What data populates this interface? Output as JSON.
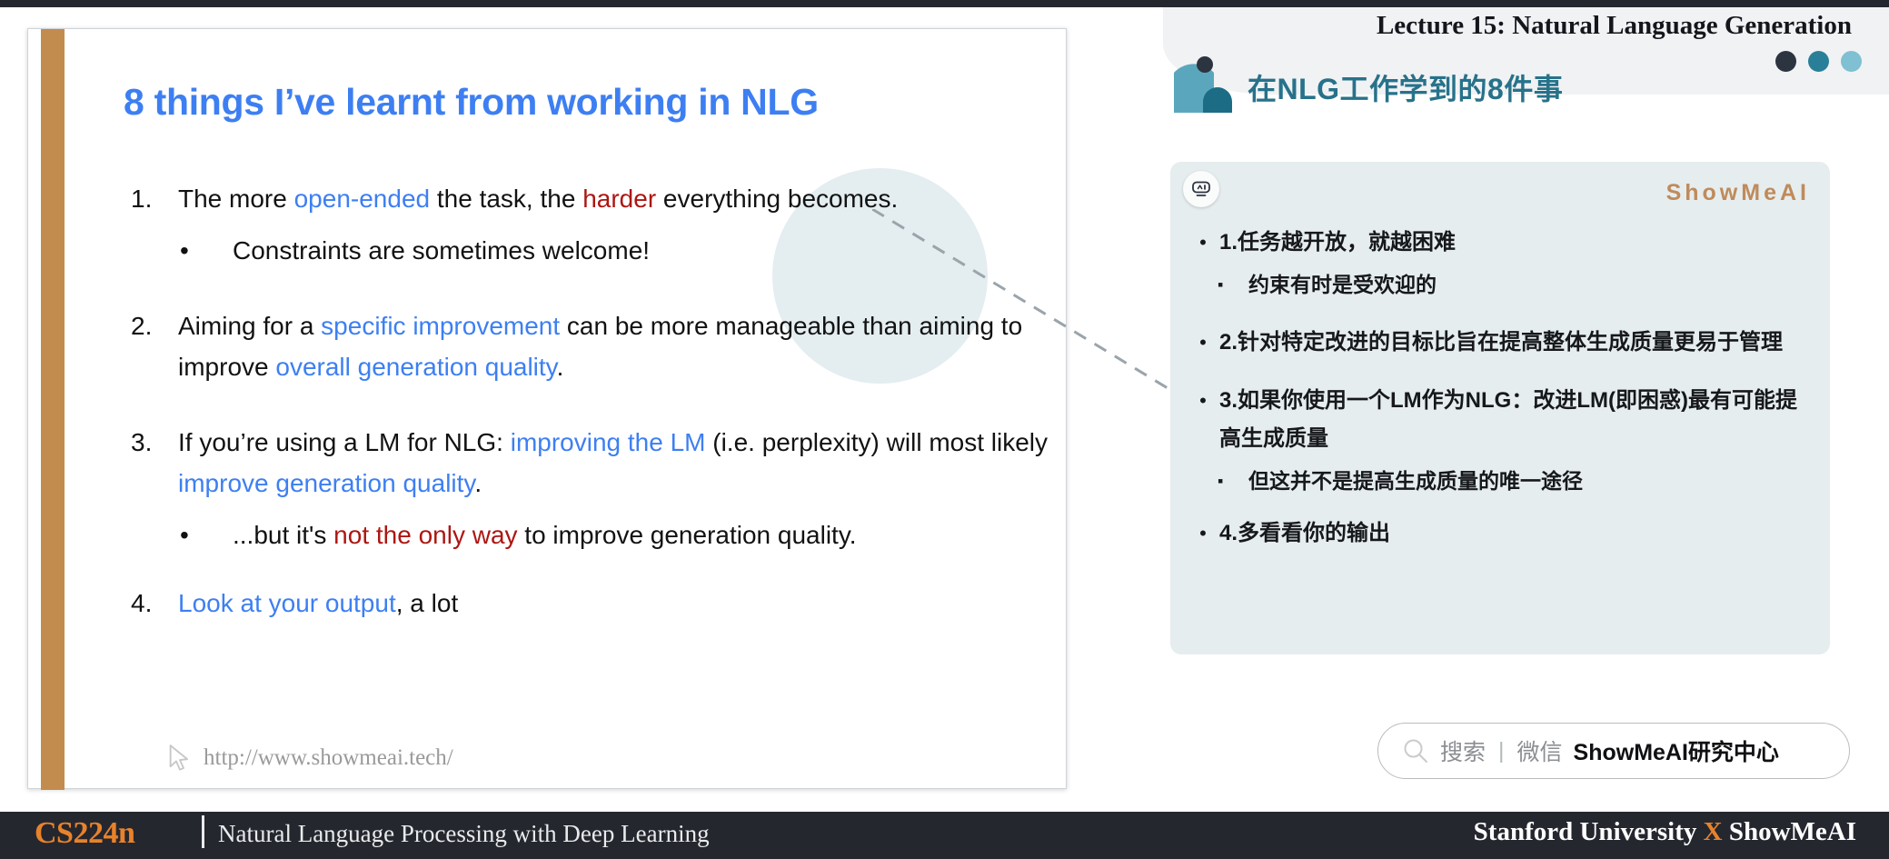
{
  "slide": {
    "title": "8 things I’ve learnt from working in NLG",
    "items": [
      {
        "num": "1.",
        "parts": [
          {
            "t": "The more ",
            "c": "plain"
          },
          {
            "t": "open-ended",
            "c": "blue"
          },
          {
            "t": " the task, the ",
            "c": "plain"
          },
          {
            "t": "harder",
            "c": "red"
          },
          {
            "t": " everything becomes.",
            "c": "plain"
          }
        ],
        "sub": [
          {
            "bullet": "•",
            "parts": [
              {
                "t": "Constraints are sometimes welcome!",
                "c": "plain"
              }
            ]
          }
        ]
      },
      {
        "num": "2.",
        "parts": [
          {
            "t": "Aiming for a ",
            "c": "plain"
          },
          {
            "t": "specific improvement",
            "c": "blue"
          },
          {
            "t": " can be more manageable than aiming to improve ",
            "c": "plain"
          },
          {
            "t": "overall generation quality",
            "c": "blue"
          },
          {
            "t": ".",
            "c": "plain"
          }
        ],
        "sub": []
      },
      {
        "num": "3.",
        "parts": [
          {
            "t": "If you’re using a LM for NLG: ",
            "c": "plain"
          },
          {
            "t": "improving the LM",
            "c": "blue"
          },
          {
            "t": " (i.e. perplexity) will most likely ",
            "c": "plain"
          },
          {
            "t": "improve generation quality",
            "c": "blue"
          },
          {
            "t": ".",
            "c": "plain"
          }
        ],
        "sub": [
          {
            "bullet": "•",
            "parts": [
              {
                "t": "...but it's ",
                "c": "plain"
              },
              {
                "t": "not the only way",
                "c": "red"
              },
              {
                "t": " to improve generation quality.",
                "c": "plain"
              }
            ]
          }
        ]
      },
      {
        "num": "4.",
        "parts": [
          {
            "t": "Look at your output",
            "c": "blue"
          },
          {
            "t": ", a lot",
            "c": "plain"
          }
        ],
        "sub": []
      }
    ],
    "url": "http://www.showmeai.tech/"
  },
  "right_panel": {
    "lecture_title": "Lecture 15: Natural Language Generation",
    "cn_title": "在NLG工作学到的8件事",
    "brand": "ShowMeAI",
    "items": [
      {
        "bullet": "•",
        "text": "1.任务越开放，就越困难",
        "sub": [
          {
            "bullet": "▪",
            "text": "约束有时是受欢迎的"
          }
        ]
      },
      {
        "bullet": "•",
        "text": "2.针对特定改进的目标比旨在提高整体生成质量更易于管理",
        "sub": []
      },
      {
        "bullet": "•",
        "text": "3.如果你使用一个LM作为NLG：改进LM(即困惑)最有可能提高生成质量",
        "sub": [
          {
            "bullet": "▪",
            "text": "但这并不是提高生成质量的唯一途径"
          }
        ]
      },
      {
        "bullet": "•",
        "text": "4.多看看你的输出",
        "sub": []
      }
    ],
    "search": {
      "label": "搜索",
      "divider": "|",
      "channel": "微信",
      "account": "ShowMeAI研究中心"
    }
  },
  "footer": {
    "course_code": "CS224n",
    "course_name": "Natural Language Processing with Deep Learning",
    "org_left": "Stanford University ",
    "org_x": "X",
    "org_right": " ShowMeAI"
  },
  "colors": {
    "accent_blue": "#3d7ff2",
    "accent_red": "#ad1612",
    "slide_bar": "#c28c4e",
    "teal": "#2a7f98",
    "teal_light": "#7fc0d2",
    "brand_bronze": "#bf8b5b",
    "orange": "#e8822a",
    "footer_bg": "#25272f",
    "card_bg": "#e6edef"
  }
}
